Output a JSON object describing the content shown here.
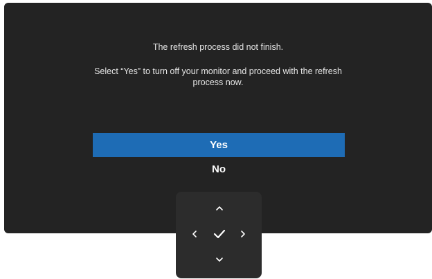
{
  "dialog": {
    "title": "The refresh process did not finish.",
    "body": "Select “Yes” to turn off your monitor and proceed with the refresh process now.",
    "options": [
      {
        "label": "Yes",
        "selected": true
      },
      {
        "label": "No",
        "selected": false
      }
    ]
  },
  "nav_pad": {
    "buttons": [
      "chevron-up-icon",
      "chevron-left-icon",
      "checkmark-icon",
      "chevron-right-icon",
      "chevron-down-icon"
    ]
  },
  "colors": {
    "panel_background": "#232323",
    "selection_highlight": "#1e6cb5",
    "nav_pad_background": "#2c2c2c",
    "text": "#ffffff"
  }
}
